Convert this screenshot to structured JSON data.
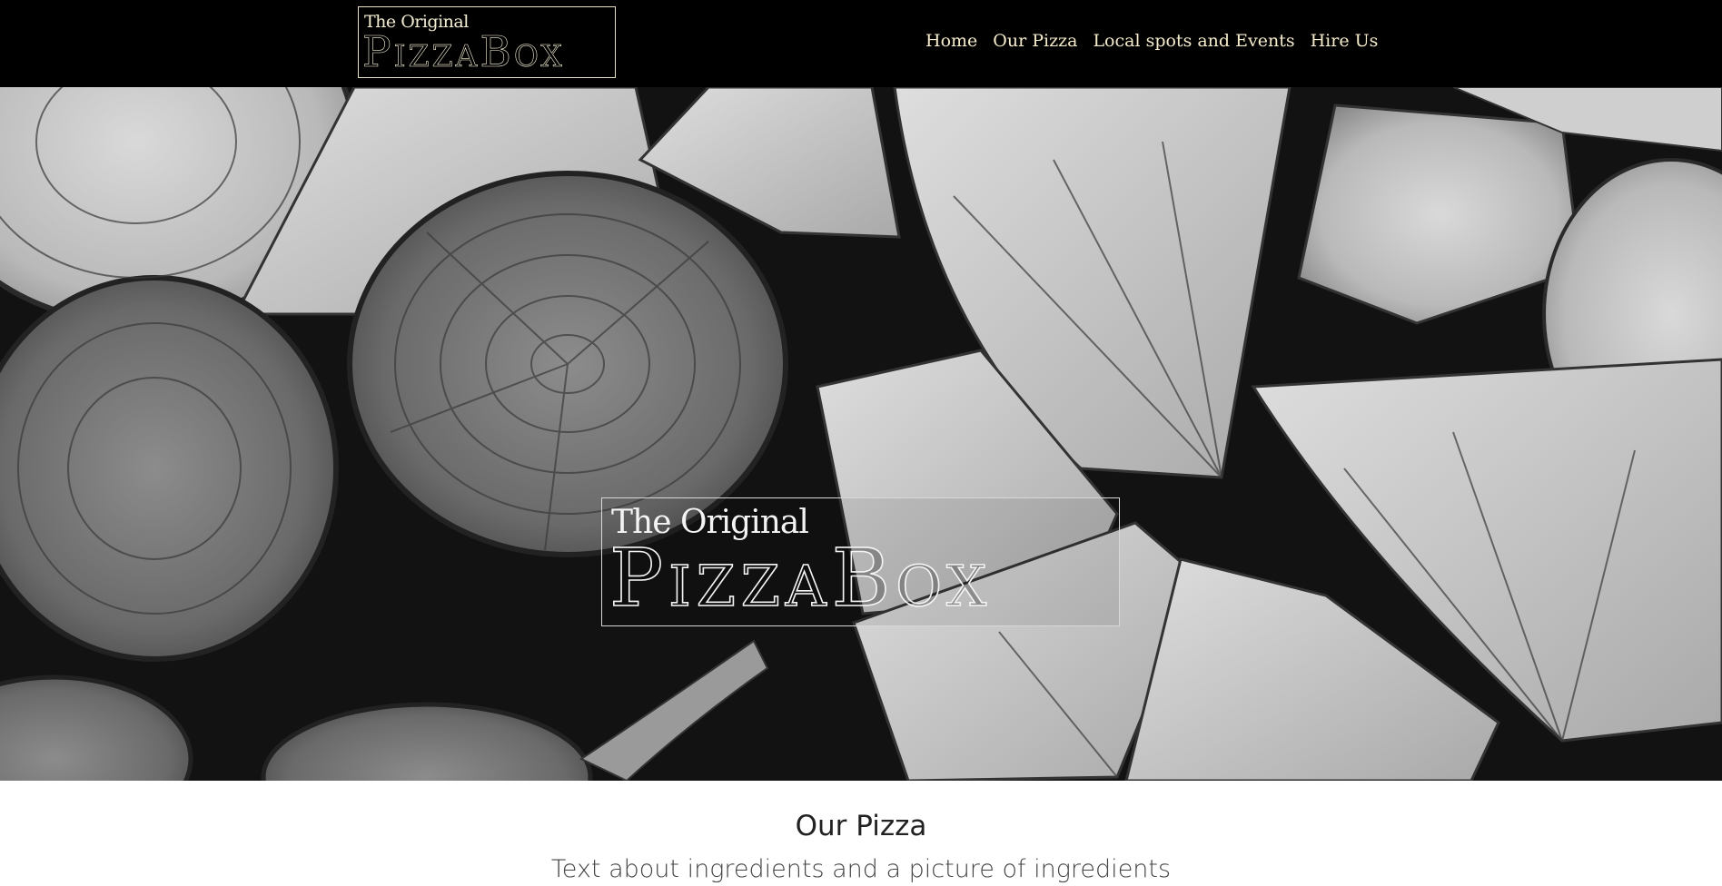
{
  "header": {
    "logo": {
      "line1": "The Original",
      "line2": "PizzaBox"
    },
    "nav": [
      {
        "label": "Home"
      },
      {
        "label": "Our Pizza"
      },
      {
        "label": "Local spots and Events"
      },
      {
        "label": "Hire Us"
      }
    ]
  },
  "hero": {
    "background": "stacked firewood logs, black and white photo",
    "logo": {
      "line1": "The Original",
      "line2": "PizzaBox"
    }
  },
  "section": {
    "title": "Our Pizza",
    "text": "Text about ingredients and a picture of ingredients"
  },
  "colors": {
    "header_bg": "#000000",
    "nav_text": "#f6eccb",
    "heading": "#222222",
    "body_text": "#444444"
  }
}
